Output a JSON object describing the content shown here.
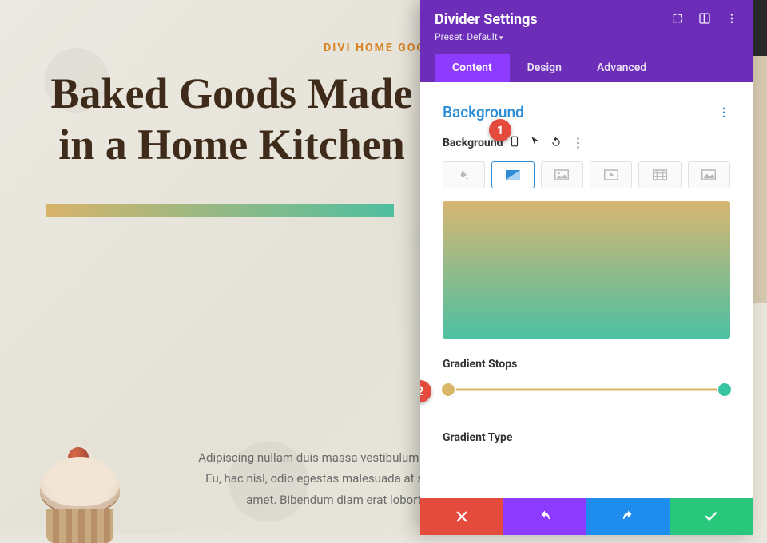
{
  "page": {
    "eyebrow": "DIVI HOME GOODS",
    "headline": "Baked Goods Made in a Home Kitchen",
    "body": "Adipiscing nullam duis massa vestibulum convallis justo est. Eu, hac nisl, odio egestas malesuada at semper vel viverra amet. Bibendum diam erat lobortis posuer."
  },
  "panel": {
    "title": "Divider Settings",
    "preset": "Preset: Default",
    "tabs": [
      {
        "label": "Content",
        "active": true
      },
      {
        "label": "Design",
        "active": false
      },
      {
        "label": "Advanced",
        "active": false
      }
    ],
    "section": "Background",
    "bg_field_label": "Background",
    "bg_types": [
      "color",
      "gradient",
      "image",
      "video",
      "pattern",
      "mask"
    ],
    "bg_active_type": "gradient",
    "gradient_preview": {
      "from": "#d8b673",
      "to": "#4dc0a1",
      "angle": 180
    },
    "stops_label": "Gradient Stops",
    "stops": [
      {
        "pos": 0,
        "color": "#dcb667"
      },
      {
        "pos": 100,
        "color": "#37c4a0"
      }
    ],
    "type_label": "Gradient Type"
  },
  "annotations": [
    {
      "n": "1"
    },
    {
      "n": "2"
    }
  ]
}
